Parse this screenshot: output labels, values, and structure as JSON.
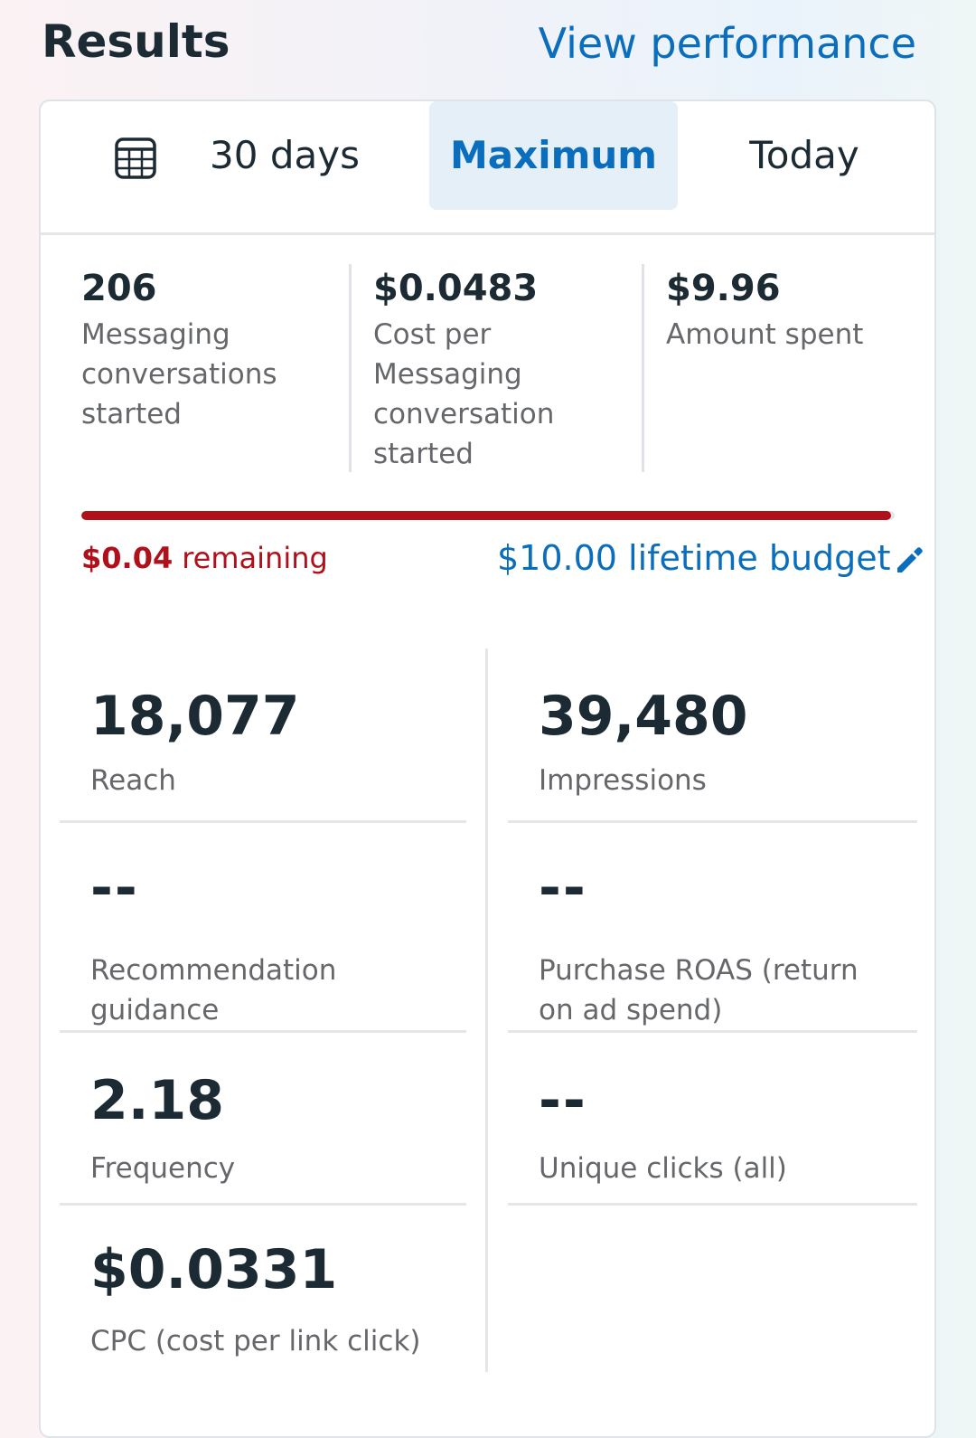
{
  "header": {
    "title": "Results",
    "view_link": "View performance"
  },
  "tabs": [
    {
      "label": "30 days",
      "selected": false
    },
    {
      "label": "Maximum",
      "selected": true
    },
    {
      "label": "Today",
      "selected": false
    }
  ],
  "summary": [
    {
      "value": "206",
      "label": "Messaging conversations started"
    },
    {
      "value": "$0.0483",
      "label": "Cost per Messaging conversation started"
    },
    {
      "value": "$9.96",
      "label": "Amount spent"
    }
  ],
  "budget": {
    "remaining_amount": "$0.04",
    "remaining_text": "remaining",
    "lifetime_text": "$10.00 lifetime budget",
    "spent_fraction": 0.996,
    "bar_color": "#b0101a"
  },
  "metrics": [
    {
      "value": "18,077",
      "label": "Reach"
    },
    {
      "value": "39,480",
      "label": "Impressions"
    },
    {
      "value": "--",
      "label": "Recommendation guidance"
    },
    {
      "value": "--",
      "label": "Purchase ROAS (return on ad spend)"
    },
    {
      "value": "2.18",
      "label": "Frequency"
    },
    {
      "value": "--",
      "label": "Unique clicks (all)"
    },
    {
      "value": "$0.0331",
      "label": "CPC (cost per link click)"
    }
  ],
  "colors": {
    "accent": "#0a6ebd",
    "warning": "#b0101a",
    "selected_tab_bg": "#e4eff8"
  },
  "icons": {
    "calendar": "calendar-icon",
    "edit": "pencil-icon"
  }
}
